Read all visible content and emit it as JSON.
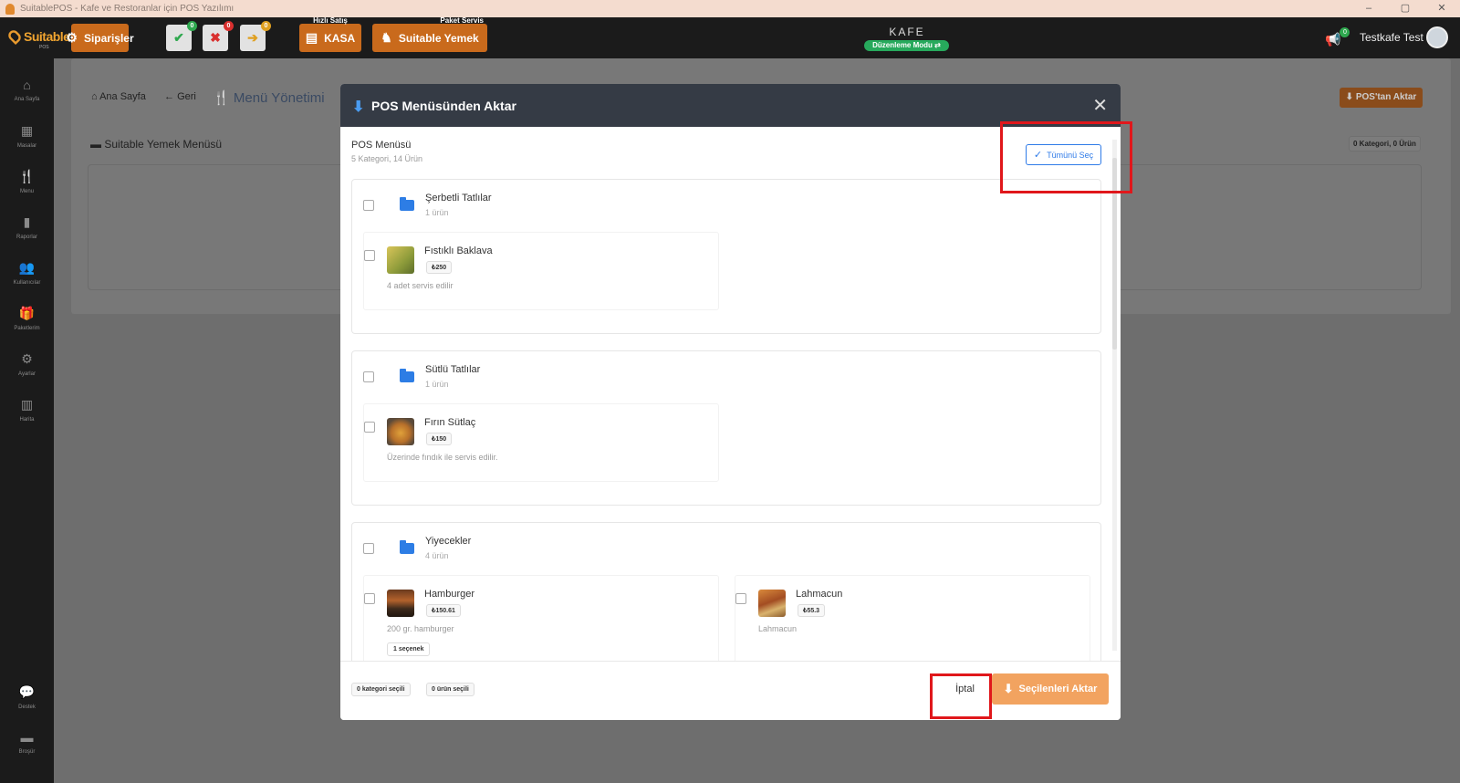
{
  "window": {
    "title": "SuitablePOS - Kafe ve Restoranlar için POS Yazılımı",
    "controls": [
      "–",
      "▢",
      "✕"
    ]
  },
  "nav": {
    "logo": "Suitable",
    "logo_sub": "POS",
    "orders_label": "Siparişler",
    "badges": {
      "approve": "0",
      "reject": "0",
      "forward": "0"
    },
    "quick_sale_caption": "Hızlı Satış",
    "kasa_label": "KASA",
    "package_caption": "Paket Servis",
    "suitable_yemek_label": "Suitable Yemek",
    "venue": "KAFE",
    "mode": "Düzenleme Modu",
    "notif_count": "0",
    "user_name": "Testkafe Test"
  },
  "sidebar": {
    "items": [
      {
        "label": "Ana Sayfa",
        "icon": "home-icon"
      },
      {
        "label": "Masalar",
        "icon": "table-icon"
      },
      {
        "label": "Menu",
        "icon": "utensils-icon"
      },
      {
        "label": "Raporlar",
        "icon": "report-icon"
      },
      {
        "label": "Kullanıcılar",
        "icon": "users-icon"
      },
      {
        "label": "Paketlerim",
        "icon": "gift-icon"
      },
      {
        "label": "Ayarlar",
        "icon": "cogs-icon"
      },
      {
        "label": "Harita",
        "icon": "map-icon"
      }
    ],
    "bottom": [
      {
        "label": "Destek",
        "icon": "chat-icon"
      },
      {
        "label": "Broşür",
        "icon": "brochure-icon"
      }
    ]
  },
  "page": {
    "breadcrumb_home": "Ana Sayfa",
    "back": "Geri",
    "title": "Menü Yönetimi",
    "pos_import_button": "POS'tan Aktar",
    "section_title": "Suitable Yemek Menüsü",
    "section_count": "0 Kategori, 0 Ürün"
  },
  "modal": {
    "title": "POS Menüsünden Aktar",
    "menu_title": "POS Menüsü",
    "menu_summary": "5 Kategori, 14 Ürün",
    "select_all": "Tümünü Seç",
    "categories": [
      {
        "name": "Şerbetli Tatlılar",
        "count": "1 ürün",
        "products": [
          {
            "name": "Fıstıklı Baklava",
            "price": "₺250",
            "desc": "4 adet servis edilir",
            "option": ""
          }
        ]
      },
      {
        "name": "Sütlü Tatlılar",
        "count": "1 ürün",
        "products": [
          {
            "name": "Fırın Sütlaç",
            "price": "₺150",
            "desc": "Üzerinde fındık ile servis edilir.",
            "option": ""
          }
        ]
      },
      {
        "name": "Yiyecekler",
        "count": "4 ürün",
        "products": [
          {
            "name": "Hamburger",
            "price": "₺150.61",
            "desc": "200 gr. hamburger",
            "option": "1 seçenek"
          },
          {
            "name": "Lahmacun",
            "price": "₺55.3",
            "desc": "Lahmacun",
            "option": ""
          }
        ]
      }
    ],
    "footer": {
      "categories_selected": "0 kategori seçili",
      "products_selected": "0 ürün seçili",
      "cancel": "İptal",
      "import_selected": "Seçilenleri Aktar"
    }
  },
  "colors": {
    "accent": "#c96a1c",
    "primary": "#2f7be8",
    "highlight": "#e0171b",
    "import": "#f2a360"
  }
}
